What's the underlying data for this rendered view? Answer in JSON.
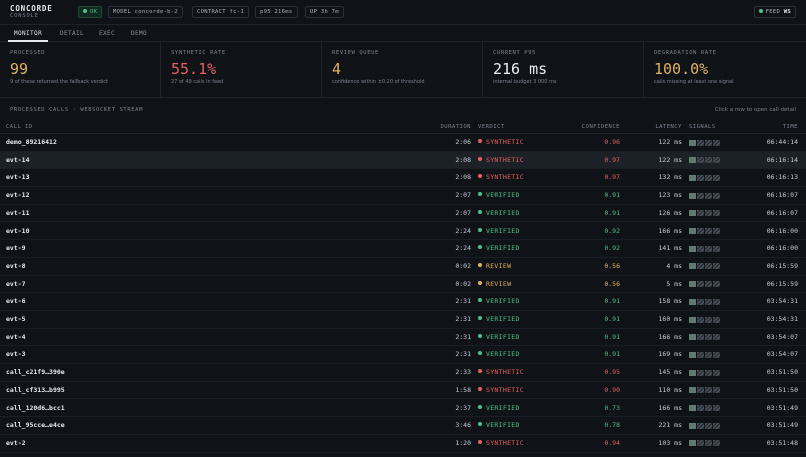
{
  "app": {
    "title": "CONCORDE",
    "subtitle": "CONSOLE"
  },
  "status_pills": [
    {
      "label": "OK",
      "kind": "ok"
    },
    {
      "label": "MODEL concorde-b-2",
      "kind": "info"
    },
    {
      "label": "CONTRACT fc-1",
      "kind": "info"
    },
    {
      "label": "p95 216ms",
      "kind": "info"
    },
    {
      "label": "UP 3h 7m",
      "kind": "info"
    }
  ],
  "feed": {
    "label": "FEED",
    "value": "WS"
  },
  "tabs": [
    {
      "label": "MONITOR",
      "active": true
    },
    {
      "label": "DETAIL",
      "active": false
    },
    {
      "label": "EXEC",
      "active": false
    },
    {
      "label": "DEMO",
      "active": false
    }
  ],
  "stats": [
    {
      "label": "PROCESSED",
      "value": "99",
      "note": "9 of these returned the fallback verdict",
      "color": "#e3b25c"
    },
    {
      "label": "SYNTHETIC RATE",
      "value": "55.1%",
      "note": "27 of 49 calls in feed",
      "color": "#e8625b"
    },
    {
      "label": "REVIEW QUEUE",
      "value": "4",
      "note": "confidence within ±0.20 of threshold",
      "color": "#e3b25c"
    },
    {
      "label": "CURRENT P95",
      "value": "216 ms",
      "note": "internal budget 3 000 ms",
      "color": "#eef0f3"
    },
    {
      "label": "DEGRADATION RATE",
      "value": "100.0%",
      "note": "calls missing at least one signal",
      "color": "#e3b25c"
    }
  ],
  "section": {
    "title": "PROCESSED CALLS · WEBSOCKET STREAM",
    "hint": "Click a row to open call detail"
  },
  "table": {
    "columns": {
      "call_id": "CALL ID",
      "duration": "DURATION",
      "verdict": "VERDICT",
      "confidence": "CONFIDENCE",
      "latency": "LATENCY",
      "signals": "SIGNALS",
      "time": "TIME"
    },
    "rows": [
      {
        "id": "demo_89216412",
        "duration": "2:06",
        "verdict": "SYNTHETIC",
        "confidence": "0.96",
        "latency": "122 ms",
        "time": "06:44:14"
      },
      {
        "id": "evt-14",
        "duration": "2:08",
        "verdict": "SYNTHETIC",
        "confidence": "0.97",
        "latency": "122 ms",
        "time": "06:16:14",
        "selected": true
      },
      {
        "id": "evt-13",
        "duration": "2:08",
        "verdict": "SYNTHETIC",
        "confidence": "0.97",
        "latency": "132 ms",
        "time": "06:16:13"
      },
      {
        "id": "evt-12",
        "duration": "2:07",
        "verdict": "VERIFIED",
        "confidence": "0.91",
        "latency": "123 ms",
        "time": "06:16:07"
      },
      {
        "id": "evt-11",
        "duration": "2:07",
        "verdict": "VERIFIED",
        "confidence": "0.91",
        "latency": "126 ms",
        "time": "06:16:07"
      },
      {
        "id": "evt-10",
        "duration": "2:24",
        "verdict": "VERIFIED",
        "confidence": "0.92",
        "latency": "166 ms",
        "time": "06:16:00"
      },
      {
        "id": "evt-9",
        "duration": "2:24",
        "verdict": "VERIFIED",
        "confidence": "0.92",
        "latency": "141 ms",
        "time": "06:16:00"
      },
      {
        "id": "evt-8",
        "duration": "0:02",
        "verdict": "REVIEW",
        "confidence": "0.56",
        "latency": "4 ms",
        "time": "06:15:59"
      },
      {
        "id": "evt-7",
        "duration": "0:02",
        "verdict": "REVIEW",
        "confidence": "0.56",
        "latency": "5 ms",
        "time": "06:15:59"
      },
      {
        "id": "evt-6",
        "duration": "2:31",
        "verdict": "VERIFIED",
        "confidence": "0.91",
        "latency": "158 ms",
        "time": "03:54:31"
      },
      {
        "id": "evt-5",
        "duration": "2:31",
        "verdict": "VERIFIED",
        "confidence": "0.91",
        "latency": "160 ms",
        "time": "03:54:31"
      },
      {
        "id": "evt-4",
        "duration": "2:31",
        "verdict": "VERIFIED",
        "confidence": "0.91",
        "latency": "166 ms",
        "time": "03:54:07"
      },
      {
        "id": "evt-3",
        "duration": "2:31",
        "verdict": "VERIFIED",
        "confidence": "0.91",
        "latency": "169 ms",
        "time": "03:54:07"
      },
      {
        "id": "call_c21f9…390e",
        "duration": "2:33",
        "verdict": "SYNTHETIC",
        "confidence": "0.95",
        "latency": "145 ms",
        "time": "03:51:50"
      },
      {
        "id": "call_cf313…b995",
        "duration": "1:58",
        "verdict": "SYNTHETIC",
        "confidence": "0.90",
        "latency": "110 ms",
        "time": "03:51:50"
      },
      {
        "id": "call_120d6…bcc1",
        "duration": "2:37",
        "verdict": "VERIFIED",
        "confidence": "0.73",
        "latency": "166 ms",
        "time": "03:51:49"
      },
      {
        "id": "call_95cce…e4ce",
        "duration": "3:46",
        "verdict": "VERIFIED",
        "confidence": "0.78",
        "latency": "221 ms",
        "time": "03:51:49"
      },
      {
        "id": "evt-2",
        "duration": "1:20",
        "verdict": "SYNTHETIC",
        "confidence": "0.94",
        "latency": "103 ms",
        "time": "03:51:48"
      }
    ]
  },
  "colors": {
    "synthetic": "#e8625b",
    "verified": "#4cc38a",
    "review": "#e3b25c",
    "signal_on": "#5f7a70"
  }
}
